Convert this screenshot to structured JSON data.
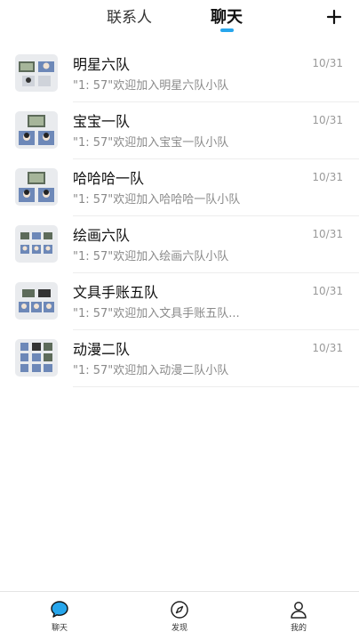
{
  "header": {
    "tabs": [
      {
        "label": "联系人"
      },
      {
        "label": "聊天"
      }
    ],
    "add_button": "+"
  },
  "chats": [
    {
      "title": "明星六队",
      "preview": "\"1:                57\"欢迎加入明星六队小队",
      "time": "10/31"
    },
    {
      "title": "宝宝一队",
      "preview": "\"1:                57\"欢迎加入宝宝一队小队",
      "time": "10/31"
    },
    {
      "title": "哈哈哈一队",
      "preview": "\"1:                57\"欢迎加入哈哈哈一队小队",
      "time": "10/31"
    },
    {
      "title": "绘画六队",
      "preview": "\"1:                57\"欢迎加入绘画六队小队",
      "time": "10/31"
    },
    {
      "title": "文具手账五队",
      "preview": "\"1:                57\"欢迎加入文具手账五队...",
      "time": "10/31"
    },
    {
      "title": "动漫二队",
      "preview": "\"1:                57\"欢迎加入动漫二队小队",
      "time": "10/31"
    }
  ],
  "bottom_nav": [
    {
      "label": "聊天",
      "icon": "chat-bubble-icon"
    },
    {
      "label": "发现",
      "icon": "compass-icon"
    },
    {
      "label": "我的",
      "icon": "person-icon"
    }
  ],
  "colors": {
    "accent": "#27a6ec",
    "avatar_bg": "#e9ebee",
    "divider": "#ededed"
  }
}
